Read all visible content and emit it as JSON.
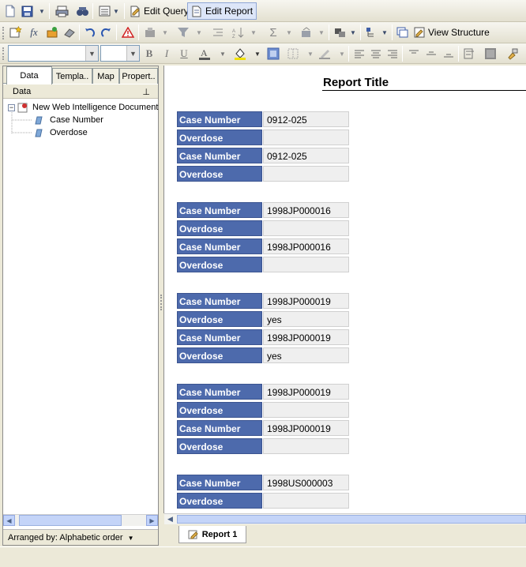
{
  "toolbar": {
    "edit_query_label": "Edit Query",
    "edit_report_label": "Edit Report",
    "view_structure_label": "View Structure"
  },
  "left_panel": {
    "tabs": [
      {
        "label": "Data"
      },
      {
        "label": "Templa.."
      },
      {
        "label": "Map"
      },
      {
        "label": "Propert.."
      }
    ],
    "header": "Data",
    "tree": {
      "root": "New Web Intelligence Document",
      "children": [
        "Case Number",
        "Overdose"
      ]
    },
    "arranged_by": "Arranged by: Alphabetic order"
  },
  "report": {
    "title": "Report Title",
    "label_case": "Case Number",
    "label_overdose": "Overdose",
    "blocks": [
      {
        "rows": [
          {
            "label": "Case Number",
            "value": "0912-025"
          },
          {
            "label": "Overdose",
            "value": ""
          },
          {
            "label": "Case Number",
            "value": "0912-025"
          },
          {
            "label": "Overdose",
            "value": ""
          }
        ]
      },
      {
        "rows": [
          {
            "label": "Case Number",
            "value": "1998JP000016"
          },
          {
            "label": "Overdose",
            "value": ""
          },
          {
            "label": "Case Number",
            "value": "1998JP000016"
          },
          {
            "label": "Overdose",
            "value": ""
          }
        ]
      },
      {
        "rows": [
          {
            "label": "Case Number",
            "value": "1998JP000019"
          },
          {
            "label": "Overdose",
            "value": "yes"
          },
          {
            "label": "Case Number",
            "value": "1998JP000019"
          },
          {
            "label": "Overdose",
            "value": "yes"
          }
        ]
      },
      {
        "rows": [
          {
            "label": "Case Number",
            "value": "1998JP000019"
          },
          {
            "label": "Overdose",
            "value": ""
          },
          {
            "label": "Case Number",
            "value": "1998JP000019"
          },
          {
            "label": "Overdose",
            "value": ""
          }
        ]
      },
      {
        "rows": [
          {
            "label": "Case Number",
            "value": "1998US000003"
          },
          {
            "label": "Overdose",
            "value": ""
          }
        ]
      }
    ],
    "tab_label": "Report 1"
  },
  "colors": {
    "header_cell": "#4d6aac",
    "value_cell": "#efefef",
    "chrome": "#ece9d8"
  }
}
